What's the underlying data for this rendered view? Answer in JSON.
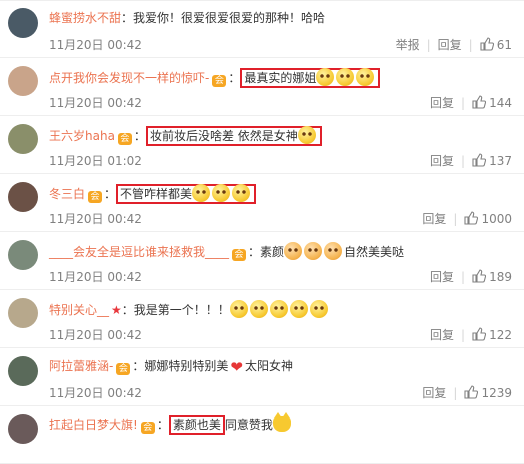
{
  "comments": [
    {
      "user": "蜂蜜捞水不甜",
      "vip": false,
      "star": false,
      "text": "：我爱你！很爱很爱很爱的那种！哈哈",
      "emojis_after": 0,
      "highlight": "",
      "date": "11月20日 00:42",
      "report": "举报",
      "reply": "回复",
      "likes": "61",
      "avatar_color": "#4a5a66"
    },
    {
      "user": "点开我你会发现不一样的惊吓-",
      "vip": true,
      "star": false,
      "text": "：",
      "emojis_after": 0,
      "highlight": "最真实的娜姐",
      "highlight_emojis": 3,
      "date": "11月20日 00:42",
      "report": "",
      "reply": "回复",
      "likes": "144",
      "avatar_color": "#c9a48a"
    },
    {
      "user": "王六岁haha",
      "vip": true,
      "star": false,
      "text": "：",
      "emojis_after": 0,
      "highlight": "妆前妆后没啥差 依然是女神",
      "highlight_emojis": 1,
      "date": "11月20日 01:02",
      "report": "",
      "reply": "回复",
      "likes": "137",
      "avatar_color": "#8a8f6a"
    },
    {
      "user": "冬三白",
      "vip": true,
      "star": false,
      "text": "：",
      "emojis_after": 0,
      "highlight": "不管咋样都美",
      "highlight_emojis": 3,
      "date": "11月20日 00:42",
      "report": "",
      "reply": "回复",
      "likes": "1000",
      "avatar_color": "#6b5146"
    },
    {
      "user": "____会友全是逗比谁来拯救我____",
      "vip": true,
      "star": false,
      "text": "：素颜",
      "emojis_after": 3,
      "text2": "自然美美哒",
      "highlight": "",
      "date": "11月20日 00:42",
      "report": "",
      "reply": "回复",
      "likes": "189",
      "avatar_color": "#7a8a7a"
    },
    {
      "user": "特别关心__",
      "vip": false,
      "star": true,
      "text": "：我是第一个！！！",
      "emojis_after": 5,
      "highlight": "",
      "date": "11月20日 00:42",
      "report": "",
      "reply": "回复",
      "likes": "122",
      "avatar_color": "#b7a88c"
    },
    {
      "user": "阿拉蕾雅涵-",
      "vip": true,
      "star": false,
      "text": "：娜娜特别特别美",
      "emojis_after": 0,
      "heart": true,
      "text2": "太阳女神",
      "highlight": "",
      "date": "11月20日 00:42",
      "report": "",
      "reply": "回复",
      "likes": "1239",
      "avatar_color": "#5a6a5a"
    },
    {
      "user": "扛起白日梦大旗!",
      "vip": true,
      "star": false,
      "text": "：",
      "emojis_after": 0,
      "highlight": "素颜也美",
      "text2": "同意赞我",
      "cat": true,
      "date": "",
      "report": "",
      "reply": "",
      "likes": "",
      "avatar_color": "#6a5a5a"
    }
  ],
  "vip_glyph": "会",
  "star_glyph": "★",
  "heart_glyph": "❤",
  "separator": "|",
  "colors": {
    "username": "#eb7350",
    "highlight_border": "#e0202a",
    "meta": "#808080"
  }
}
